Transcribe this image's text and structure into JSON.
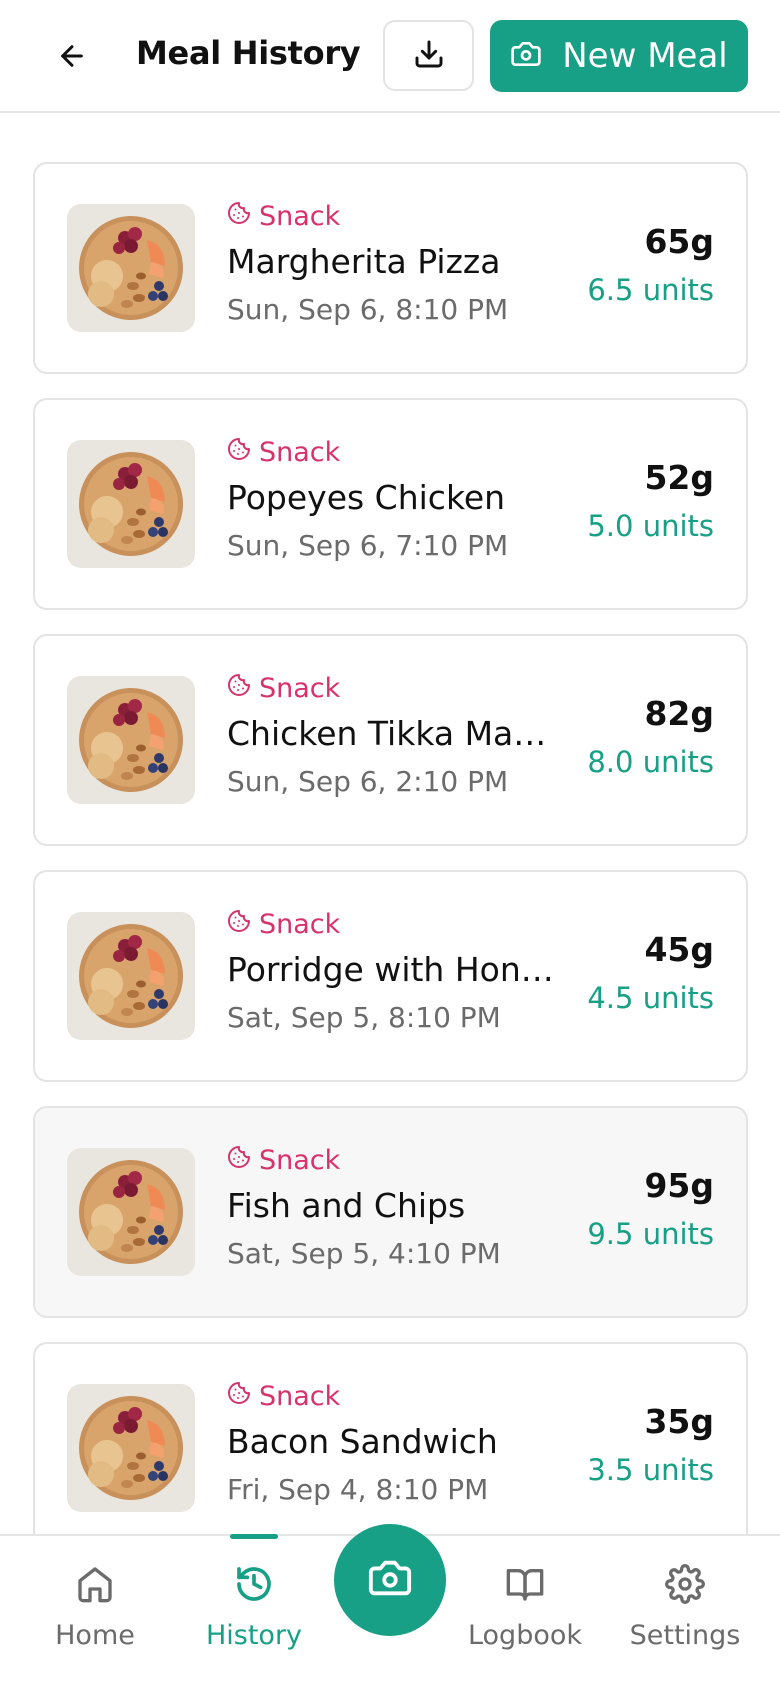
{
  "header": {
    "title": "Meal History",
    "new_meal_label": "New Meal"
  },
  "meals": [
    {
      "category": "Snack",
      "name": "Margherita Pizza",
      "date": "Sun, Sep 6, 8:10 PM",
      "carbs": "65g",
      "units": "6.5 units"
    },
    {
      "category": "Snack",
      "name": "Popeyes Chicken",
      "date": "Sun, Sep 6, 7:10 PM",
      "carbs": "52g",
      "units": "5.0 units"
    },
    {
      "category": "Snack",
      "name": "Chicken Tikka Mas...",
      "date": "Sun, Sep 6, 2:10 PM",
      "carbs": "82g",
      "units": "8.0 units"
    },
    {
      "category": "Snack",
      "name": "Porridge with Honey",
      "date": "Sat, Sep 5, 8:10 PM",
      "carbs": "45g",
      "units": "4.5 units"
    },
    {
      "category": "Snack",
      "name": "Fish and Chips",
      "date": "Sat, Sep 5, 4:10 PM",
      "carbs": "95g",
      "units": "9.5 units"
    },
    {
      "category": "Snack",
      "name": "Bacon Sandwich",
      "date": "Fri, Sep 4, 8:10 PM",
      "carbs": "35g",
      "units": "3.5 units"
    }
  ],
  "nav": {
    "home": "Home",
    "history": "History",
    "logbook": "Logbook",
    "settings": "Settings",
    "selected": "history"
  },
  "colors": {
    "accent": "#17a085",
    "category": "#d6336c",
    "muted_text": "#6b6b6b"
  },
  "icons": {
    "back": "arrow-left-icon",
    "export": "download-icon",
    "new_meal": "camera-icon",
    "category": "cookie-icon",
    "home": "home-icon",
    "history": "history-icon",
    "capture": "camera-icon",
    "logbook": "book-open-icon",
    "settings": "gear-icon"
  }
}
